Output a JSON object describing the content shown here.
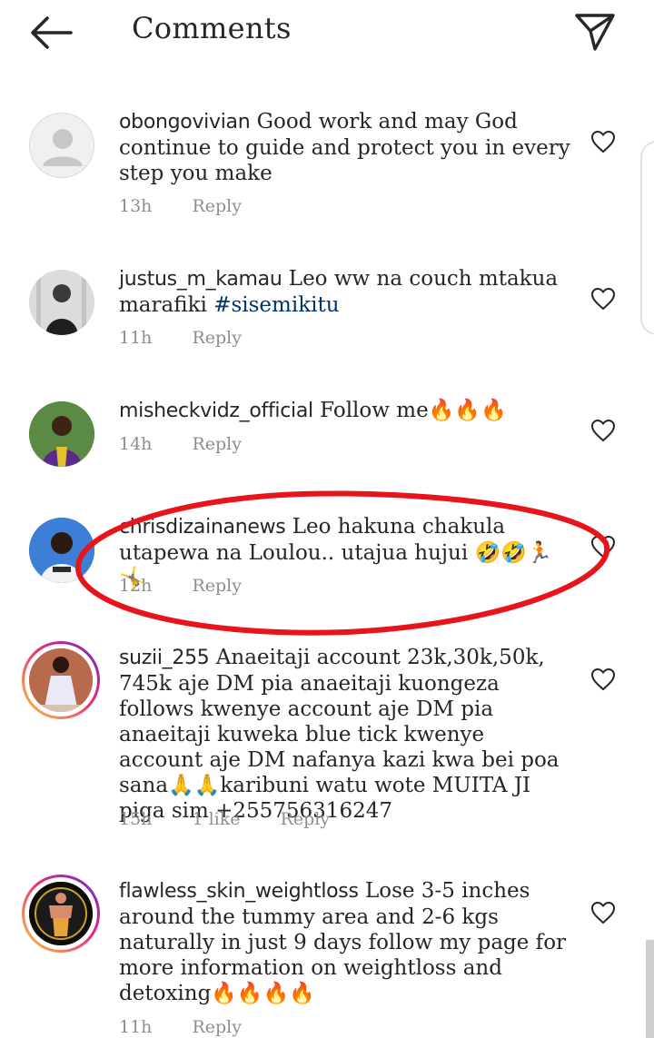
{
  "header": {
    "title": "Comments"
  },
  "reply_label": "Reply",
  "colors": {
    "link": "#003569",
    "annotation": "#e8141b",
    "meta": "#8e8e8e"
  },
  "comments": [
    {
      "username": "obongovivian",
      "text": "Good work and may God continue to  guide and protect you in every step you make",
      "time": "13h",
      "avatar_icon": "default-avatar-icon"
    },
    {
      "username": "justus_m_kamau",
      "text": "Leo ww na couch mtakua marafiki ",
      "hashtag": "#sisemikitu",
      "time": "11h",
      "avatar_icon": "person-photo"
    },
    {
      "username": "misheckvidz_official",
      "text": "Follow me🔥🔥🔥",
      "time": "14h",
      "avatar_icon": "person-photo"
    },
    {
      "username": "chrisdizainanews",
      "text": "Leo hakuna chakula utapewa na Loulou.. utajua hujui 🤣🤣🏃🤸",
      "time": "12h",
      "avatar_icon": "person-photo"
    },
    {
      "username": "suzii_255",
      "text": "Anaeitaji account 23k,30k,50k, 745k aje DM pia anaeitaji kuongeza follows kwenye account aje DM pia anaeitaji kuweka blue tick kwenye account aje DM nafanya kazi kwa bei poa sana🙏🙏karibuni watu wote MUITA JI piga sim +255756316247",
      "time": "15h",
      "likes": "1 like",
      "avatar_icon": "story-avatar"
    },
    {
      "username": "flawless_skin_weightloss",
      "text": "Lose 3-5 inches around the tummy area and 2-6 kgs naturally in just 9 days follow my page for more information on weightloss and detoxing🔥🔥🔥🔥",
      "time": "11h",
      "avatar_icon": "story-avatar"
    }
  ]
}
